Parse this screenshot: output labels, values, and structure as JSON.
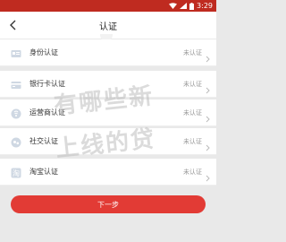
{
  "status_bar": {
    "time": "3:29",
    "colors": {
      "background": "#bf2b20"
    }
  },
  "header": {
    "title": "认证"
  },
  "items": [
    {
      "label": "身份认证",
      "status": "未认证",
      "icon": "id-card-icon"
    },
    {
      "label": "银行卡认证",
      "status": "未认证",
      "icon": "bank-card-icon"
    },
    {
      "label": "运营商认证",
      "status": "未认证",
      "icon": "carrier-icon"
    },
    {
      "label": "社交认证",
      "status": "未认证",
      "icon": "social-icon"
    },
    {
      "label": "淘宝认证",
      "status": "未认证",
      "icon": "taobao-icon"
    }
  ],
  "watermark": {
    "line1": "有哪些新",
    "line2": "上线的贷"
  },
  "footer": {
    "next_label": "下一步"
  },
  "colors": {
    "accent": "#e23b35",
    "status_text": "#999999",
    "page_bg": "#e9e9e9"
  }
}
